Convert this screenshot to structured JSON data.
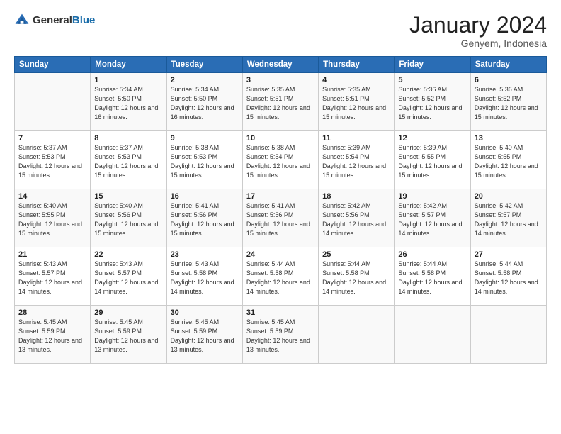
{
  "logo": {
    "general": "General",
    "blue": "Blue"
  },
  "header": {
    "month": "January 2024",
    "location": "Genyem, Indonesia"
  },
  "weekdays": [
    "Sunday",
    "Monday",
    "Tuesday",
    "Wednesday",
    "Thursday",
    "Friday",
    "Saturday"
  ],
  "weeks": [
    [
      {
        "day": "",
        "sunrise": "",
        "sunset": "",
        "daylight": ""
      },
      {
        "day": "1",
        "sunrise": "Sunrise: 5:34 AM",
        "sunset": "Sunset: 5:50 PM",
        "daylight": "Daylight: 12 hours and 16 minutes."
      },
      {
        "day": "2",
        "sunrise": "Sunrise: 5:34 AM",
        "sunset": "Sunset: 5:50 PM",
        "daylight": "Daylight: 12 hours and 16 minutes."
      },
      {
        "day": "3",
        "sunrise": "Sunrise: 5:35 AM",
        "sunset": "Sunset: 5:51 PM",
        "daylight": "Daylight: 12 hours and 15 minutes."
      },
      {
        "day": "4",
        "sunrise": "Sunrise: 5:35 AM",
        "sunset": "Sunset: 5:51 PM",
        "daylight": "Daylight: 12 hours and 15 minutes."
      },
      {
        "day": "5",
        "sunrise": "Sunrise: 5:36 AM",
        "sunset": "Sunset: 5:52 PM",
        "daylight": "Daylight: 12 hours and 15 minutes."
      },
      {
        "day": "6",
        "sunrise": "Sunrise: 5:36 AM",
        "sunset": "Sunset: 5:52 PM",
        "daylight": "Daylight: 12 hours and 15 minutes."
      }
    ],
    [
      {
        "day": "7",
        "sunrise": "Sunrise: 5:37 AM",
        "sunset": "Sunset: 5:53 PM",
        "daylight": "Daylight: 12 hours and 15 minutes."
      },
      {
        "day": "8",
        "sunrise": "Sunrise: 5:37 AM",
        "sunset": "Sunset: 5:53 PM",
        "daylight": "Daylight: 12 hours and 15 minutes."
      },
      {
        "day": "9",
        "sunrise": "Sunrise: 5:38 AM",
        "sunset": "Sunset: 5:53 PM",
        "daylight": "Daylight: 12 hours and 15 minutes."
      },
      {
        "day": "10",
        "sunrise": "Sunrise: 5:38 AM",
        "sunset": "Sunset: 5:54 PM",
        "daylight": "Daylight: 12 hours and 15 minutes."
      },
      {
        "day": "11",
        "sunrise": "Sunrise: 5:39 AM",
        "sunset": "Sunset: 5:54 PM",
        "daylight": "Daylight: 12 hours and 15 minutes."
      },
      {
        "day": "12",
        "sunrise": "Sunrise: 5:39 AM",
        "sunset": "Sunset: 5:55 PM",
        "daylight": "Daylight: 12 hours and 15 minutes."
      },
      {
        "day": "13",
        "sunrise": "Sunrise: 5:40 AM",
        "sunset": "Sunset: 5:55 PM",
        "daylight": "Daylight: 12 hours and 15 minutes."
      }
    ],
    [
      {
        "day": "14",
        "sunrise": "Sunrise: 5:40 AM",
        "sunset": "Sunset: 5:55 PM",
        "daylight": "Daylight: 12 hours and 15 minutes."
      },
      {
        "day": "15",
        "sunrise": "Sunrise: 5:40 AM",
        "sunset": "Sunset: 5:56 PM",
        "daylight": "Daylight: 12 hours and 15 minutes."
      },
      {
        "day": "16",
        "sunrise": "Sunrise: 5:41 AM",
        "sunset": "Sunset: 5:56 PM",
        "daylight": "Daylight: 12 hours and 15 minutes."
      },
      {
        "day": "17",
        "sunrise": "Sunrise: 5:41 AM",
        "sunset": "Sunset: 5:56 PM",
        "daylight": "Daylight: 12 hours and 15 minutes."
      },
      {
        "day": "18",
        "sunrise": "Sunrise: 5:42 AM",
        "sunset": "Sunset: 5:56 PM",
        "daylight": "Daylight: 12 hours and 14 minutes."
      },
      {
        "day": "19",
        "sunrise": "Sunrise: 5:42 AM",
        "sunset": "Sunset: 5:57 PM",
        "daylight": "Daylight: 12 hours and 14 minutes."
      },
      {
        "day": "20",
        "sunrise": "Sunrise: 5:42 AM",
        "sunset": "Sunset: 5:57 PM",
        "daylight": "Daylight: 12 hours and 14 minutes."
      }
    ],
    [
      {
        "day": "21",
        "sunrise": "Sunrise: 5:43 AM",
        "sunset": "Sunset: 5:57 PM",
        "daylight": "Daylight: 12 hours and 14 minutes."
      },
      {
        "day": "22",
        "sunrise": "Sunrise: 5:43 AM",
        "sunset": "Sunset: 5:57 PM",
        "daylight": "Daylight: 12 hours and 14 minutes."
      },
      {
        "day": "23",
        "sunrise": "Sunrise: 5:43 AM",
        "sunset": "Sunset: 5:58 PM",
        "daylight": "Daylight: 12 hours and 14 minutes."
      },
      {
        "day": "24",
        "sunrise": "Sunrise: 5:44 AM",
        "sunset": "Sunset: 5:58 PM",
        "daylight": "Daylight: 12 hours and 14 minutes."
      },
      {
        "day": "25",
        "sunrise": "Sunrise: 5:44 AM",
        "sunset": "Sunset: 5:58 PM",
        "daylight": "Daylight: 12 hours and 14 minutes."
      },
      {
        "day": "26",
        "sunrise": "Sunrise: 5:44 AM",
        "sunset": "Sunset: 5:58 PM",
        "daylight": "Daylight: 12 hours and 14 minutes."
      },
      {
        "day": "27",
        "sunrise": "Sunrise: 5:44 AM",
        "sunset": "Sunset: 5:58 PM",
        "daylight": "Daylight: 12 hours and 14 minutes."
      }
    ],
    [
      {
        "day": "28",
        "sunrise": "Sunrise: 5:45 AM",
        "sunset": "Sunset: 5:59 PM",
        "daylight": "Daylight: 12 hours and 13 minutes."
      },
      {
        "day": "29",
        "sunrise": "Sunrise: 5:45 AM",
        "sunset": "Sunset: 5:59 PM",
        "daylight": "Daylight: 12 hours and 13 minutes."
      },
      {
        "day": "30",
        "sunrise": "Sunrise: 5:45 AM",
        "sunset": "Sunset: 5:59 PM",
        "daylight": "Daylight: 12 hours and 13 minutes."
      },
      {
        "day": "31",
        "sunrise": "Sunrise: 5:45 AM",
        "sunset": "Sunset: 5:59 PM",
        "daylight": "Daylight: 12 hours and 13 minutes."
      },
      {
        "day": "",
        "sunrise": "",
        "sunset": "",
        "daylight": ""
      },
      {
        "day": "",
        "sunrise": "",
        "sunset": "",
        "daylight": ""
      },
      {
        "day": "",
        "sunrise": "",
        "sunset": "",
        "daylight": ""
      }
    ]
  ]
}
